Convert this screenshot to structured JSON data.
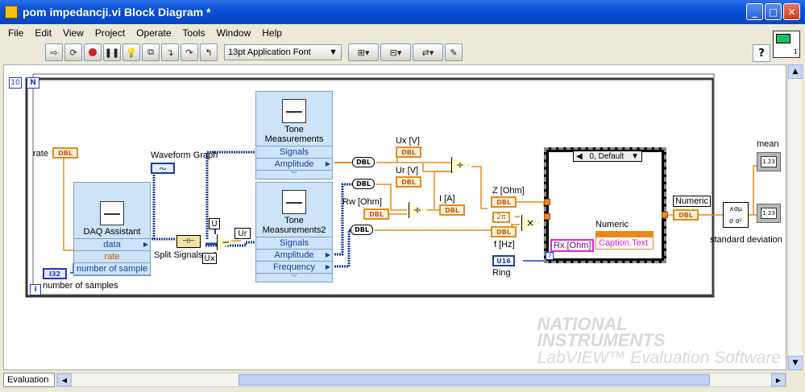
{
  "window": {
    "title": "pom impedancji.vi Block Diagram *",
    "minimize": "_",
    "maximize": "□",
    "close": "✕"
  },
  "menu": [
    "File",
    "Edit",
    "View",
    "Project",
    "Operate",
    "Tools",
    "Window",
    "Help"
  ],
  "toolbar": {
    "font": "13pt Application Font",
    "help": "?",
    "icons": [
      "run-arrow-icon",
      "run-continuous-icon",
      "abort-icon",
      "pause-icon",
      "highlight-execution-icon",
      "retain-wire-values-icon",
      "step-into-icon",
      "step-over-icon",
      "step-out-icon",
      "align-icon",
      "distribute-icon",
      "reorder-icon",
      "cleanup-icon"
    ]
  },
  "vi_icon_num": "1",
  "diagram": {
    "loop_count": "10",
    "loop_N": "N",
    "loop_i": "i",
    "rate_label": "rate",
    "num_samples_label": "number of samples",
    "waveform_graph_label": "Waveform Graph",
    "daq": {
      "name": "DAQ Assistant",
      "rows": [
        "data",
        "rate",
        "number of sample"
      ]
    },
    "tone1": {
      "name": "Tone Measurements",
      "rows": [
        "Signals",
        "Amplitude"
      ]
    },
    "tone2": {
      "name": "Tone Measurements2",
      "rows": [
        "Signals",
        "Amplitude",
        "Frequency"
      ]
    },
    "split_signals_label": "Split Signals",
    "U_label": "U",
    "Ux_label": "Ux",
    "Ur_label": "Ur",
    "ux_v_label": "Ux [V]",
    "ur_v_label": "Ur [V]",
    "rw_label": "Rw [Ohm]",
    "i_a_label": "I [A]",
    "z_label": "Z [Ohm]",
    "f_label": "f [Hz]",
    "ring_label": "Ring",
    "two_pi": "2π",
    "case_selector": "0, Default",
    "numeric_label": "Numeric",
    "numeric_ind_label": "Numeric",
    "rx_text": "Rx [Ohm]",
    "caption_text": "Caption.Text",
    "mean_label": "mean",
    "std_label": "standard deviation",
    "dbl": "DBL",
    "i32": "I32",
    "u16": "U16",
    "n123": "1.23",
    "divide": "÷",
    "multiply": "×",
    "subtract": "−",
    "question": "?"
  },
  "watermark": {
    "line1": "NATIONAL",
    "line2": "INSTRUMENTS",
    "line3": "LabVIEW™ Evaluation Software"
  },
  "bottom_tab": "Evaluation",
  "colors": {
    "dbl": "#e88a1a",
    "int": "#2233cc",
    "wire_waveform": "#1a3fa0",
    "title_bar": "#0a4fd6"
  }
}
